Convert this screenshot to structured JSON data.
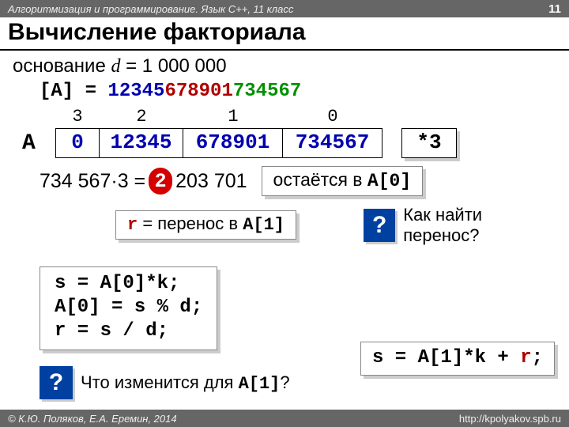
{
  "header": {
    "course": "Алгоритмизация и программирование. Язык C++, 11 класс",
    "page": "11"
  },
  "title": "Вычисление факториала",
  "base_text": {
    "prefix": "основание ",
    "var": "d",
    "eq": " = 1 000 000"
  },
  "arr": {
    "lbl": "[A] = ",
    "seg1": "12345",
    "seg2": "678901",
    "seg3": "734567"
  },
  "indices": {
    "i0": "3",
    "i1": "2",
    "i2": "1",
    "i3": "0"
  },
  "row": {
    "label": "A",
    "c0": "0",
    "c1": "12345",
    "c2": "678901",
    "c3": "734567",
    "mul": "*3"
  },
  "expr": {
    "lhs": "734 567·3 =",
    "carry_digit": "2",
    "rest": "203 701"
  },
  "rest_box": {
    "pre": "остаётся в ",
    "code": "A[0]"
  },
  "carry_box": {
    "r": "r",
    "mid": " = перенос в ",
    "code": "A[1]"
  },
  "q1": "Как найти перенос?",
  "code": {
    "l1a": "s = A[0]*k;",
    "l2a": "A[0] = s % d;",
    "l3a": "r = s / d;"
  },
  "bottom_q": {
    "pre": "Что изменится для ",
    "code": "A[1]",
    "suf": "?"
  },
  "bottom_code": {
    "s": "s = A[1]*k + ",
    "r": "r",
    "tail": ";"
  },
  "footer": {
    "copyright": "© К.Ю. Поляков, Е.А. Еремин, 2014",
    "url": "http://kpolyakov.spb.ru"
  },
  "qmark": "?"
}
